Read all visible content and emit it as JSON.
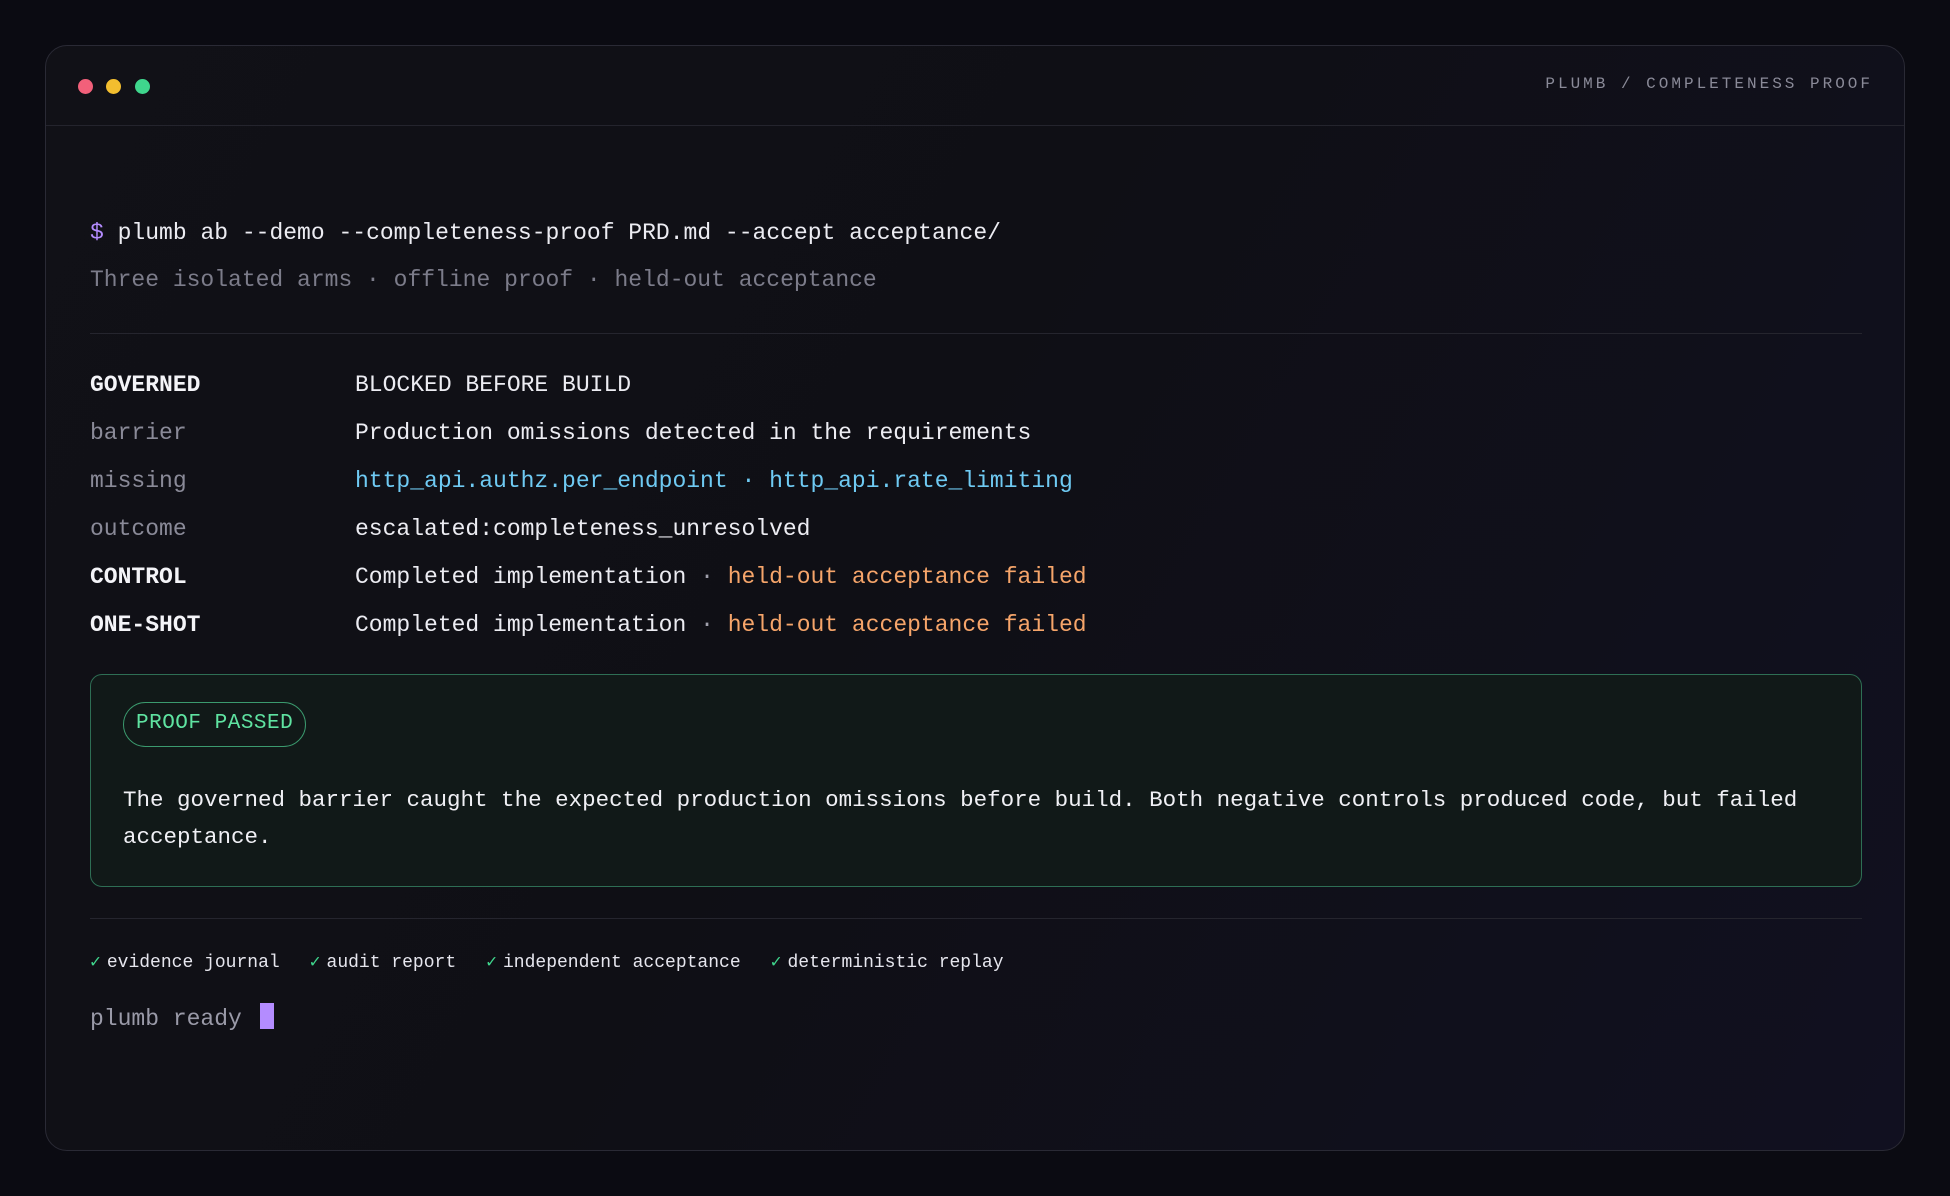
{
  "window": {
    "title": "PLUMB / COMPLETENESS PROOF"
  },
  "terminal": {
    "prompt": "$",
    "command": "plumb ab --demo --completeness-proof PRD.md --accept acceptance/",
    "subtitle": "Three isolated arms · offline proof · held-out acceptance"
  },
  "results": {
    "governed": {
      "key": "GOVERNED",
      "value": "BLOCKED BEFORE BUILD"
    },
    "barrier": {
      "key": "barrier",
      "value": "Production omissions detected in the requirements"
    },
    "missing": {
      "key": "missing",
      "item1": "http_api.authz.per_endpoint",
      "separator": " · ",
      "item2": "http_api.rate_limiting"
    },
    "outcome": {
      "key": "outcome",
      "value": "escalated:completeness_unresolved"
    },
    "control": {
      "key": "CONTROL",
      "prefix": "Completed implementation",
      "separator": " · ",
      "status": "held-out acceptance failed"
    },
    "one_shot": {
      "key": "ONE-SHOT",
      "prefix": "Completed implementation",
      "separator": " · ",
      "status": "held-out acceptance failed"
    }
  },
  "proof": {
    "badge": "PROOF PASSED",
    "message": "The governed barrier caught the expected production omissions before build. Both negative controls produced code, but failed acceptance."
  },
  "checks": [
    {
      "mark": "✓",
      "label": "evidence journal"
    },
    {
      "mark": "✓",
      "label": "audit report"
    },
    {
      "mark": "✓",
      "label": "independent acceptance"
    },
    {
      "mark": "✓",
      "label": "deterministic replay"
    }
  ],
  "footer": {
    "ready_text": "plumb ready"
  },
  "colors": {
    "accent_purple": "#b48cff",
    "warning_orange": "#f6a56a",
    "link_blue": "#6fcaf3",
    "success_green": "#3fd68d",
    "dot_red": "#f2607a",
    "dot_yellow": "#f3be2f",
    "dot_green": "#3fd68d"
  }
}
